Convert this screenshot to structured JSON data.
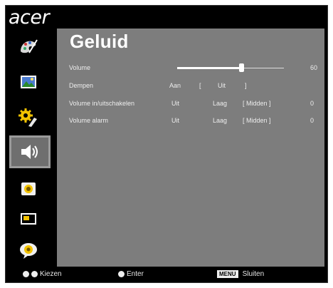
{
  "brand": "acer",
  "sidebar": {
    "items": [
      {
        "icon": "color-wheel-icon"
      },
      {
        "icon": "picture-icon"
      },
      {
        "icon": "settings-gear-icon"
      },
      {
        "icon": "speaker-icon",
        "active": true
      },
      {
        "icon": "timer-icon"
      },
      {
        "icon": "display-icon"
      },
      {
        "icon": "language-icon"
      }
    ]
  },
  "page": {
    "title": "Geluid",
    "rows": [
      {
        "label": "Volume",
        "value": "60",
        "slider_level_percent": 60
      },
      {
        "label": "Dempen",
        "options": [
          "Aan",
          "[",
          "Uit",
          "]"
        ]
      },
      {
        "label": "Volume in/uitschakelen",
        "options": [
          "Uit",
          "Laag",
          "[ Midden ]",
          "0"
        ]
      },
      {
        "label": "Volume alarm",
        "options": [
          "Uit",
          "Laag",
          "[ Midden ]",
          "0"
        ]
      }
    ]
  },
  "footer": {
    "select_label": "Kiezen",
    "enter_label": "Enter",
    "menu_key": "MENU",
    "exit_label": "Sluiten"
  },
  "colors": {
    "background": "#000000",
    "panel": "#7d7d7d",
    "active_item": "#6f6f6f",
    "text": "#ffffff"
  }
}
